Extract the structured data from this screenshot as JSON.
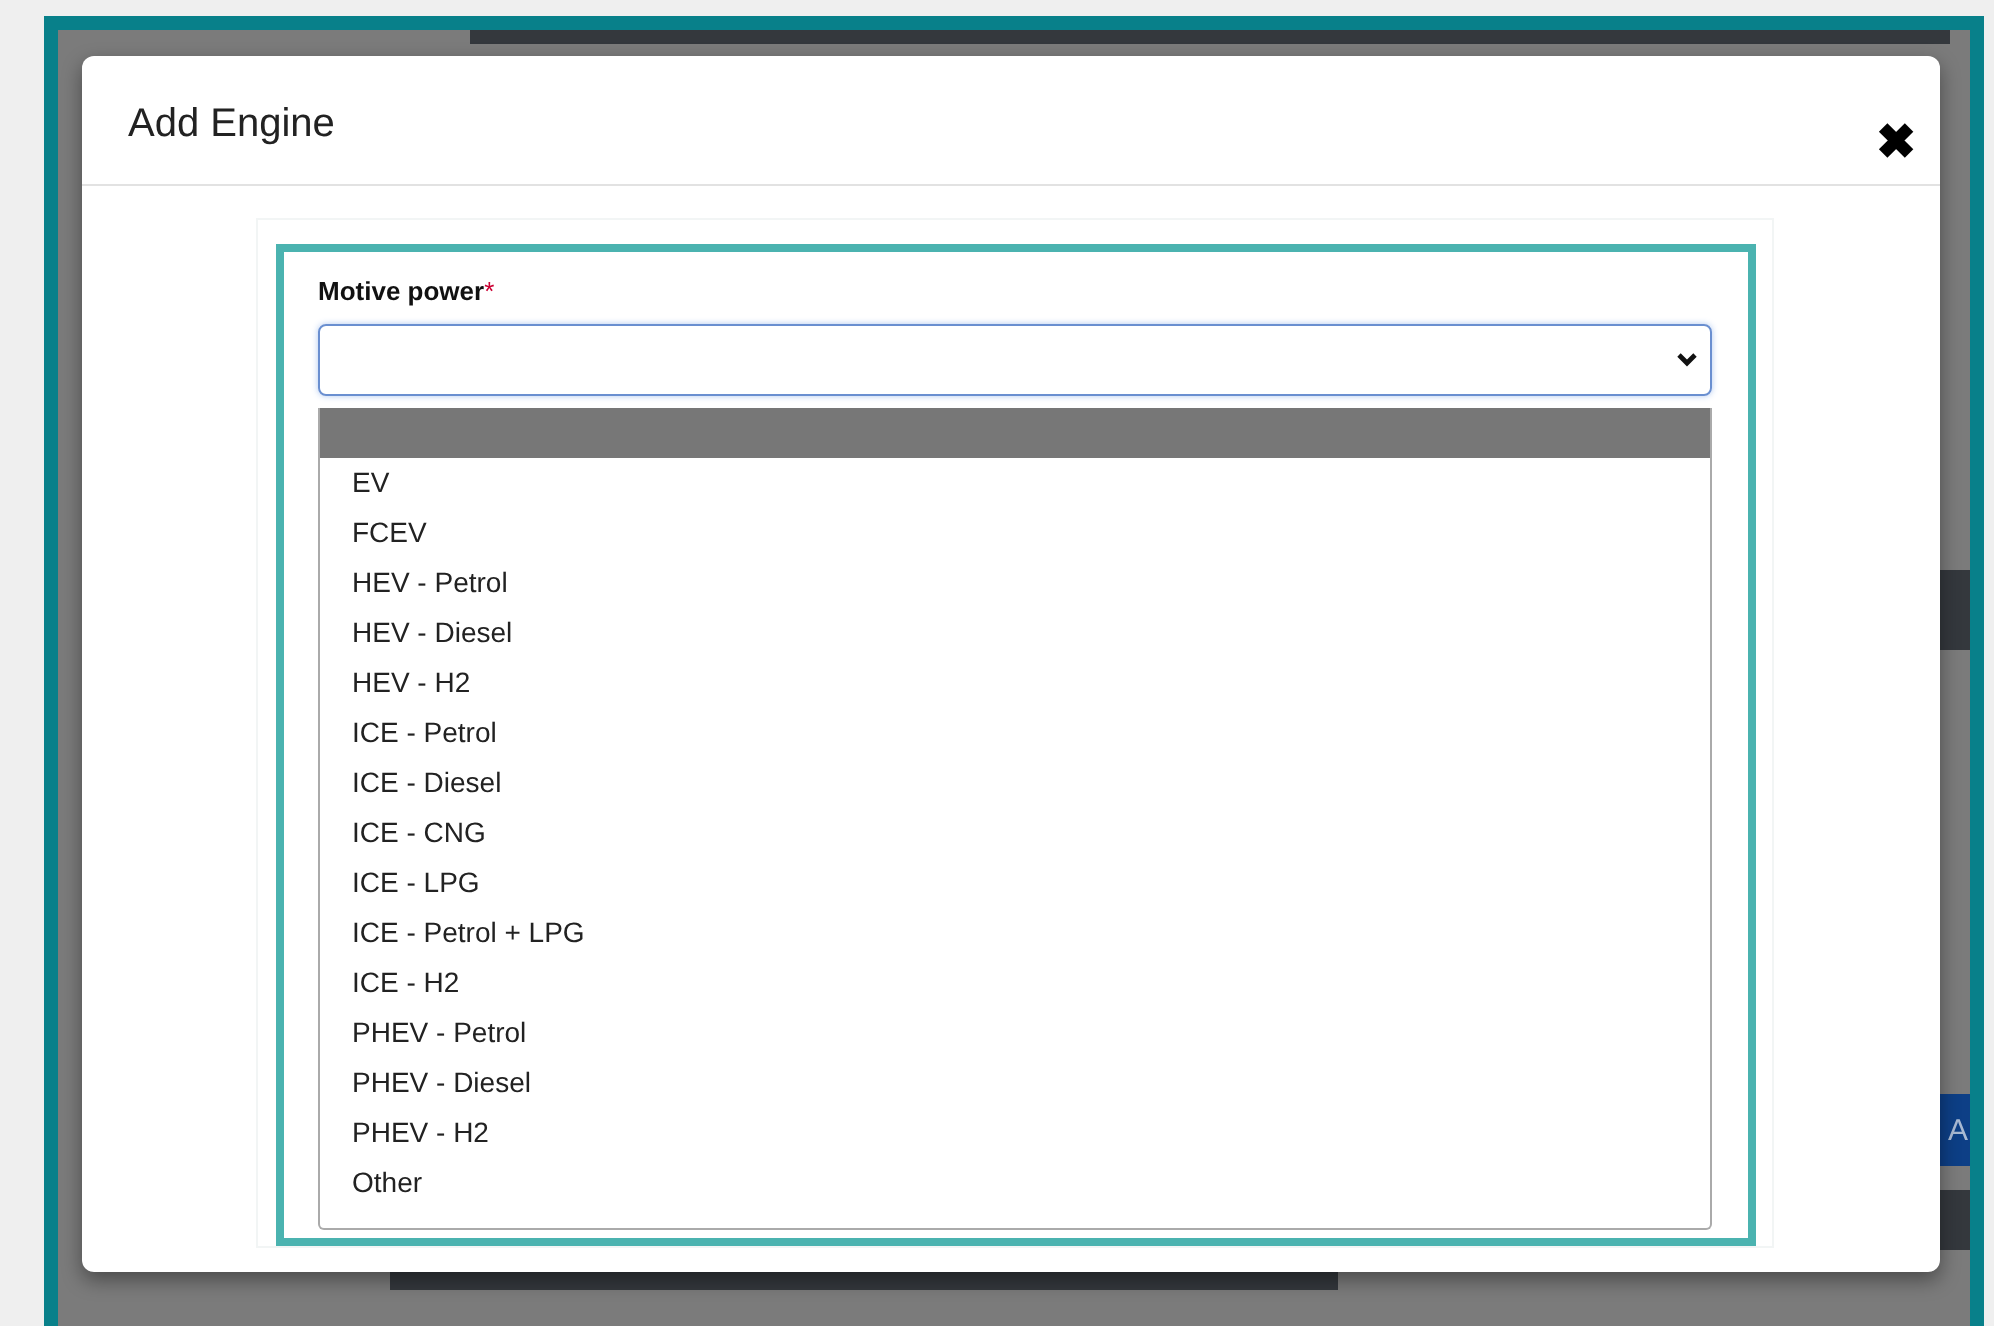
{
  "dialog": {
    "title": "Add Engine",
    "close_icon": "✖"
  },
  "field": {
    "label": "Motive power",
    "required_mark": "*"
  },
  "options": [
    {
      "selected": true
    },
    {
      "label": "EV",
      "selected": false
    },
    {
      "label": "FCEV",
      "selected": false
    },
    {
      "label": "HEV - Petrol",
      "selected": false
    },
    {
      "label": "HEV - Diesel",
      "selected": false
    },
    {
      "label": "HEV - H2",
      "selected": false
    },
    {
      "label": "ICE - Petrol",
      "selected": false
    },
    {
      "label": "ICE - Diesel",
      "selected": false
    },
    {
      "label": "ICE - CNG",
      "selected": false
    },
    {
      "label": "ICE - LPG",
      "selected": false
    },
    {
      "label": "ICE - Petrol + LPG",
      "selected": false
    },
    {
      "label": "ICE - H2",
      "selected": false
    },
    {
      "label": "PHEV - Petrol",
      "selected": false
    },
    {
      "label": "PHEV - Diesel",
      "selected": false
    },
    {
      "label": "PHEV - H2",
      "selected": false
    },
    {
      "label": "Other",
      "selected": false
    }
  ],
  "background_button": {
    "label": "A"
  }
}
